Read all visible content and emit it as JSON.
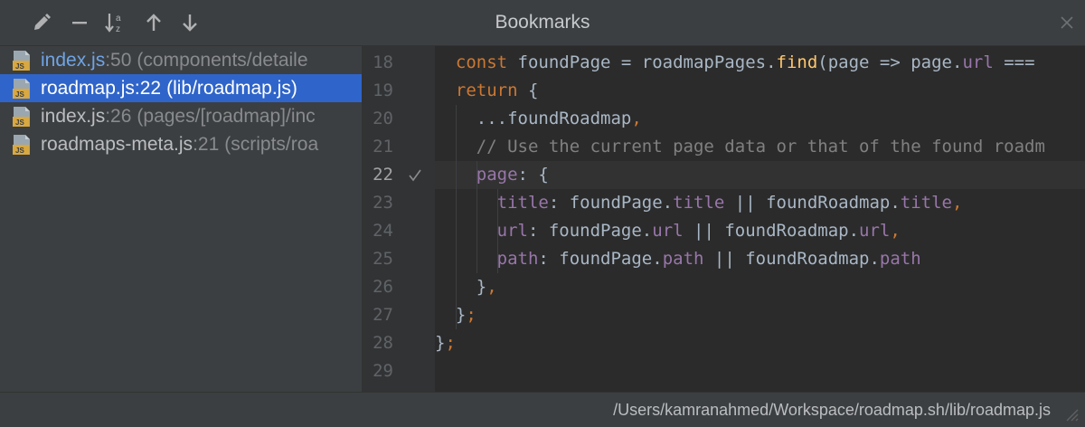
{
  "window": {
    "title": "Bookmarks"
  },
  "toolbar": {
    "buttons": [
      {
        "name": "edit-icon"
      },
      {
        "name": "minus-icon"
      },
      {
        "name": "sort-alpha-icon"
      },
      {
        "name": "arrow-up-icon"
      },
      {
        "name": "arrow-down-icon"
      }
    ],
    "close": "close-icon"
  },
  "bookmarks": [
    {
      "file": "index.js",
      "line": ":50",
      "path": "(components/detaile",
      "file_color": "blue",
      "selected": false
    },
    {
      "file": "roadmap.js",
      "line": ":22",
      "path": "(lib/roadmap.js)",
      "file_color": "default",
      "selected": true
    },
    {
      "file": "index.js",
      "line": ":26",
      "path": "(pages/[roadmap]/inc",
      "file_color": "default",
      "selected": false
    },
    {
      "file": "roadmaps-meta.js",
      "line": ":21",
      "path": "(scripts/roa",
      "file_color": "default",
      "selected": false
    }
  ],
  "editor": {
    "current_line": "22",
    "lines": [
      {
        "num": "18",
        "tokens": [
          [
            "pl",
            "  "
          ],
          [
            "kw",
            "const "
          ],
          [
            "pl",
            "foundPage = roadmapPages."
          ],
          [
            "fn",
            "find"
          ],
          [
            "pl",
            "(page => page."
          ],
          [
            "prop",
            "url"
          ],
          [
            "pl",
            " ==="
          ]
        ]
      },
      {
        "num": "19",
        "tokens": [
          [
            "pl",
            "  "
          ],
          [
            "kw",
            "return "
          ],
          [
            "pl",
            "{"
          ]
        ]
      },
      {
        "num": "20",
        "tokens": [
          [
            "pl",
            "    ...foundRoadmap"
          ],
          [
            "kw",
            ","
          ]
        ]
      },
      {
        "num": "21",
        "tokens": [
          [
            "cm",
            "    // Use the current page data or that of the found roadm"
          ]
        ]
      },
      {
        "num": "22",
        "tokens": [
          [
            "pl",
            "    "
          ],
          [
            "prop",
            "page"
          ],
          [
            "pl",
            ": {"
          ]
        ]
      },
      {
        "num": "23",
        "tokens": [
          [
            "pl",
            "      "
          ],
          [
            "prop",
            "title"
          ],
          [
            "pl",
            ": foundPage."
          ],
          [
            "prop",
            "title"
          ],
          [
            "pl",
            " || foundRoadmap."
          ],
          [
            "prop",
            "title"
          ],
          [
            "kw",
            ","
          ]
        ]
      },
      {
        "num": "24",
        "tokens": [
          [
            "pl",
            "      "
          ],
          [
            "prop",
            "url"
          ],
          [
            "pl",
            ": foundPage."
          ],
          [
            "prop",
            "url"
          ],
          [
            "pl",
            " || foundRoadmap."
          ],
          [
            "prop",
            "url"
          ],
          [
            "kw",
            ","
          ]
        ]
      },
      {
        "num": "25",
        "tokens": [
          [
            "pl",
            "      "
          ],
          [
            "prop",
            "path"
          ],
          [
            "pl",
            ": foundPage."
          ],
          [
            "prop",
            "path"
          ],
          [
            "pl",
            " || foundRoadmap."
          ],
          [
            "prop",
            "path"
          ]
        ]
      },
      {
        "num": "26",
        "tokens": [
          [
            "pl",
            "    }"
          ],
          [
            "kw",
            ","
          ]
        ]
      },
      {
        "num": "27",
        "tokens": [
          [
            "pl",
            "  }"
          ],
          [
            "kw",
            ";"
          ]
        ]
      },
      {
        "num": "28",
        "tokens": [
          [
            "pl",
            "}"
          ],
          [
            "kw",
            ";"
          ]
        ]
      },
      {
        "num": "29",
        "tokens": []
      }
    ],
    "bookmark_icon": "check-icon"
  },
  "status": {
    "path": "/Users/kamranahmed/Workspace/roadmap.sh/lib/roadmap.js"
  },
  "colors": {
    "selection": "#2f65ca",
    "keyword": "#cc7832",
    "function": "#ffc66d",
    "property": "#9876aa",
    "comment": "#808080",
    "text": "#a9b7c6"
  }
}
